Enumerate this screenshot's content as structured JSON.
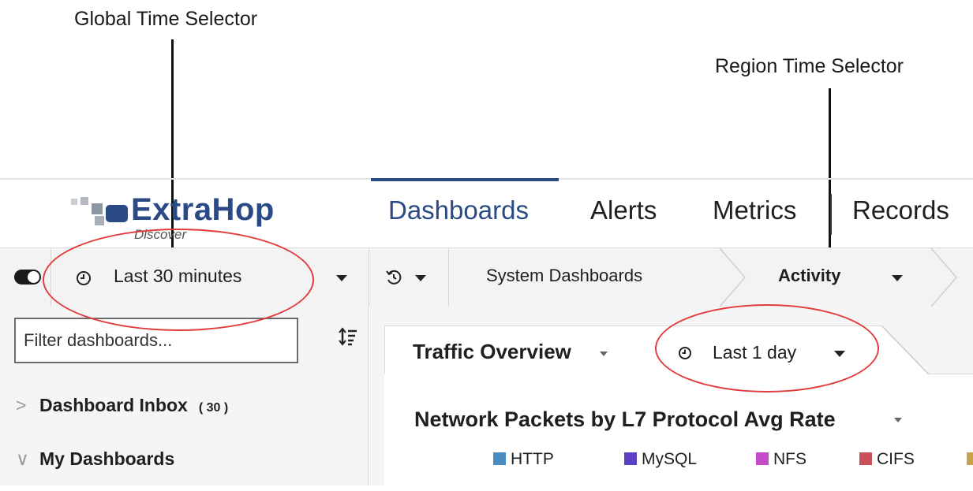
{
  "callouts": {
    "global": "Global Time Selector",
    "region": "Region Time Selector"
  },
  "logo": {
    "brand": "ExtraHop",
    "product": "Discover"
  },
  "nav": {
    "items": [
      {
        "label": "Dashboards",
        "active": true
      },
      {
        "label": "Alerts"
      },
      {
        "label": "Metrics"
      },
      {
        "label": "Records"
      }
    ]
  },
  "toolbar": {
    "global_time": "Last 30 minutes",
    "breadcrumb": [
      "System Dashboards",
      "Activity"
    ]
  },
  "sidebar": {
    "filter_placeholder": "Filter dashboards...",
    "items": [
      {
        "label": "Dashboard Inbox",
        "count": "( 30 )",
        "chevron": ">"
      },
      {
        "label": "My Dashboards",
        "chevron": "∨"
      }
    ]
  },
  "region": {
    "title": "Traffic Overview",
    "time": "Last 1 day"
  },
  "widget": {
    "title": "Network Packets by L7 Protocol Avg Rate",
    "legend": [
      {
        "name": "HTTP",
        "color": "#4a8cbf"
      },
      {
        "name": "MySQL",
        "color": "#5b3fc4"
      },
      {
        "name": "NFS",
        "color": "#c54bc9"
      },
      {
        "name": "CIFS",
        "color": "#c9505a"
      },
      {
        "name": "",
        "color": "#c9a24a"
      }
    ]
  },
  "colors": {
    "accent": "#2a4a86",
    "annotation": "#e23b3b"
  }
}
